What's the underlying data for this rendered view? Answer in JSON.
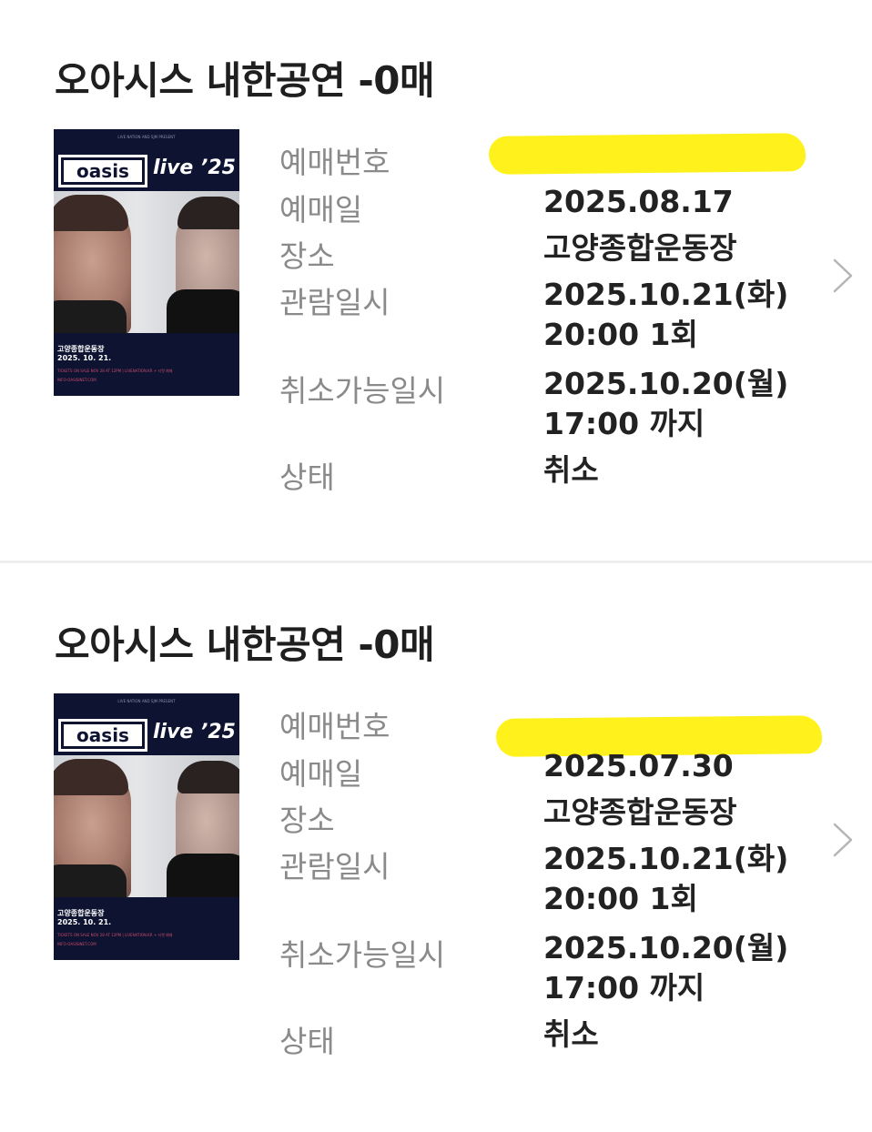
{
  "bookings": [
    {
      "title": "오아시스 내한공연  -0매",
      "poster": {
        "top_text": "LIVE NATION AND SJM PRESENT",
        "logo": "oasis",
        "tagline": "live ’25",
        "venue": "고양종합운동장",
        "date": "2025. 10. 21.",
        "fine_print": "TICKETS ON SALE NOV 28 AT 12PM  |  LIVENATION.KR + 티켓 예매",
        "url": "INFO-OASISINET.COM"
      },
      "fields": [
        {
          "label": "예매번호",
          "value": [],
          "redacted": true
        },
        {
          "label": "예매일",
          "value": [
            "2025.08.17"
          ]
        },
        {
          "label": "장소",
          "value": [
            "고양종합운동장"
          ]
        },
        {
          "label": "관람일시",
          "value": [
            "2025.10.21(화)",
            "20:00 1회"
          ]
        },
        {
          "label": "취소가능일시",
          "value": [
            "2025.10.20(월)",
            "17:00 까지"
          ]
        },
        {
          "label": "상태",
          "value": [
            "취소"
          ]
        }
      ]
    },
    {
      "title": "오아시스 내한공연  -0매",
      "poster": {
        "top_text": "LIVE NATION AND SJM PRESENT",
        "logo": "oasis",
        "tagline": "live ’25",
        "venue": "고양종합운동장",
        "date": "2025. 10. 21.",
        "fine_print": "TICKETS ON SALE NOV 28 AT 12PM  |  LIVENATION.KR + 티켓 예매",
        "url": "INFO-OASISINET.COM"
      },
      "fields": [
        {
          "label": "예매번호",
          "value": [],
          "redacted": true
        },
        {
          "label": "예매일",
          "value": [
            "2025.07.30"
          ]
        },
        {
          "label": "장소",
          "value": [
            "고양종합운동장"
          ]
        },
        {
          "label": "관람일시",
          "value": [
            "2025.10.21(화)",
            "20:00 1회"
          ]
        },
        {
          "label": "취소가능일시",
          "value": [
            "2025.10.20(월)",
            "17:00 까지"
          ]
        },
        {
          "label": "상태",
          "value": [
            "취소"
          ]
        }
      ]
    }
  ],
  "icons": {
    "detail": "chevron-right-icon"
  },
  "colors": {
    "label": "#8a8a8a",
    "value": "#222222",
    "highlight": "#fff21c",
    "divider": "#eeeeee",
    "poster_bg": "#0d1330"
  }
}
